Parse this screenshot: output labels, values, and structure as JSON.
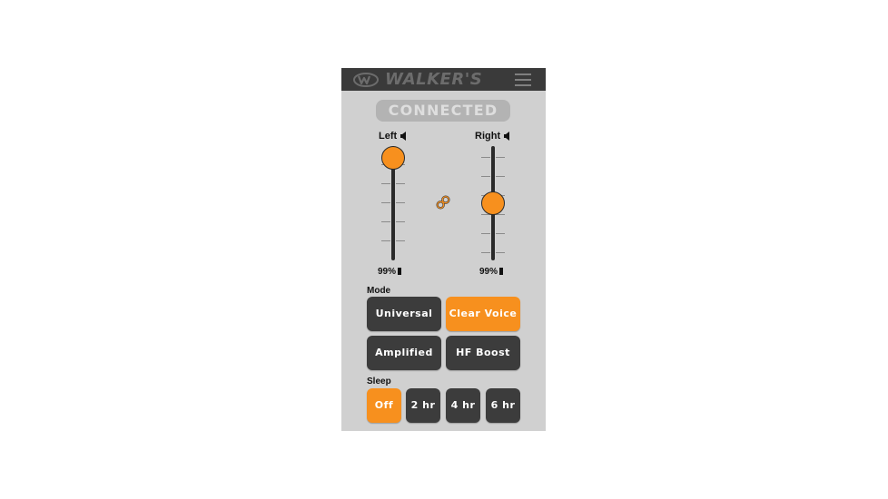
{
  "header": {
    "brand": "WALKER'S",
    "logo_icon": "walkers-w-logo",
    "menu_icon": "hamburger-menu-icon"
  },
  "status": {
    "text": "CONNECTED"
  },
  "channels": {
    "left": {
      "label": "Left",
      "battery": "99%",
      "volume_level": 1.0
    },
    "right": {
      "label": "Right",
      "battery": "99%",
      "volume_level": 0.5
    },
    "link_icon": "link-icon"
  },
  "mode": {
    "label": "Mode",
    "options": [
      {
        "label": "Universal",
        "active": false
      },
      {
        "label": "Clear Voice",
        "active": true
      },
      {
        "label": "Amplified",
        "active": false
      },
      {
        "label": "HF Boost",
        "active": false
      }
    ]
  },
  "sleep": {
    "label": "Sleep",
    "options": [
      {
        "label": "Off",
        "active": true
      },
      {
        "label": "2 hr",
        "active": false
      },
      {
        "label": "4 hr",
        "active": false
      },
      {
        "label": "6 hr",
        "active": false
      }
    ]
  },
  "colors": {
    "accent": "#f7901e",
    "button": "#3c3c3c",
    "panel": "#d0d0d0",
    "header": "#3a3a3a"
  }
}
